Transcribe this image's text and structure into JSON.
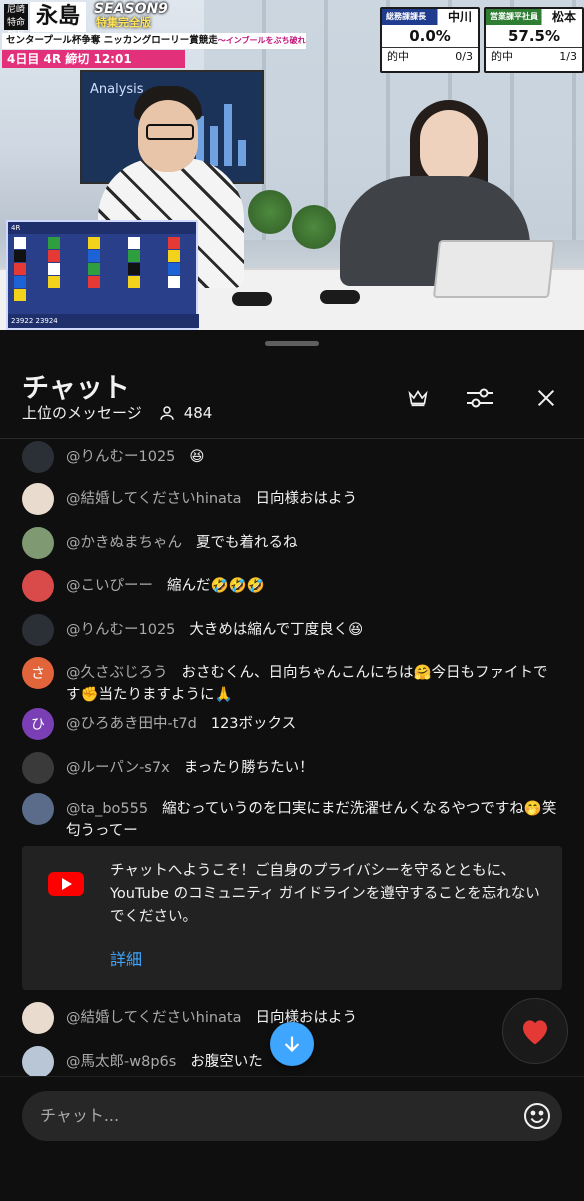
{
  "video": {
    "brand": "尼崎特命部長",
    "title_big": "永島",
    "season": "SEASON9",
    "season_sub": "特集完全版",
    "subtitle": "センタープール杯争奪 ニッカングローリー賞競走",
    "subtitle_note": "〜インブールをぶち破れ!まくってちょ〜うだい!!〜",
    "race_time": "4日目 4R 締切 12:01",
    "screen_label": "Analysis",
    "scores": [
      {
        "role": "総務課課長",
        "name": "中川",
        "pct": "0.0%",
        "hit_label": "的中",
        "hit": "0/3",
        "color": "#1f3c8f"
      },
      {
        "role": "営業課平社員",
        "name": "松本",
        "pct": "57.5%",
        "hit_label": "的中",
        "hit": "1/3",
        "color": "#2e7d32"
      }
    ],
    "race_board": {
      "header": "4R",
      "footer": "23922 23924"
    }
  },
  "chat": {
    "title": "チャット",
    "mode": "上位のメッセージ",
    "viewers": "484",
    "messages": [
      {
        "author": "@りんむー1025",
        "text": "😆",
        "avatar_color": "#2b2f36",
        "avatar_letter": ""
      },
      {
        "author": "@結婚してくださいhinata",
        "text": "日向様おはよう",
        "avatar_color": "#e9dccf",
        "avatar_letter": ""
      },
      {
        "author": "@かきぬまちゃん",
        "text": "夏でも着れるね",
        "avatar_color": "#7f9a72",
        "avatar_letter": ""
      },
      {
        "author": "@こいぴーー",
        "text": "縮んだ🤣🤣🤣",
        "avatar_color": "#d94a4a",
        "avatar_letter": ""
      },
      {
        "author": "@りんむー1025",
        "text": "大きめは縮んで丁度良く😆",
        "avatar_color": "#2b2f36",
        "avatar_letter": ""
      },
      {
        "author": "@久さぶじろう",
        "text": "おさむくん、日向ちゃんこんにちは🤗今日もファイトです✊当たりますように🙏",
        "avatar_color": "#e2643a",
        "avatar_letter": "さ"
      },
      {
        "author": "@ひろあき田中-t7d",
        "text": "123ボックス",
        "avatar_color": "#7b3fb5",
        "avatar_letter": "ひ"
      },
      {
        "author": "@ルーパン-s7x",
        "text": "まったり勝ちたい！",
        "avatar_color": "#3a3a3a",
        "avatar_letter": ""
      },
      {
        "author": "@ta_bo555",
        "text": "縮むっていうのを口実にまだ洗濯せんくなるやつですね🤭笑　匂うってー",
        "avatar_color": "#5a6c8a",
        "avatar_letter": ""
      }
    ],
    "notice": {
      "text": "チャットへようこそ！ご自身のプライバシーを守るとともに、YouTube のコミュニティ ガイドラインを遵守することを忘れないでください。",
      "more": "詳細"
    },
    "after_messages": [
      {
        "author": "@結婚してくださいhinata",
        "text": "日向様おはよう",
        "avatar_color": "#e9dccf",
        "avatar_letter": ""
      },
      {
        "author": "@馬太郎-w8p6s",
        "text": "お腹空いた",
        "avatar_color": "#b9c6d6",
        "avatar_letter": ""
      }
    ],
    "input_placeholder": "チャット...",
    "icons": {
      "crown": "crown-icon",
      "filter": "sliders-icon",
      "close": "close-icon",
      "heart": "heart-icon",
      "scroll": "arrow-down-icon",
      "emoji": "emoji-icon",
      "viewer": "person-icon"
    }
  }
}
